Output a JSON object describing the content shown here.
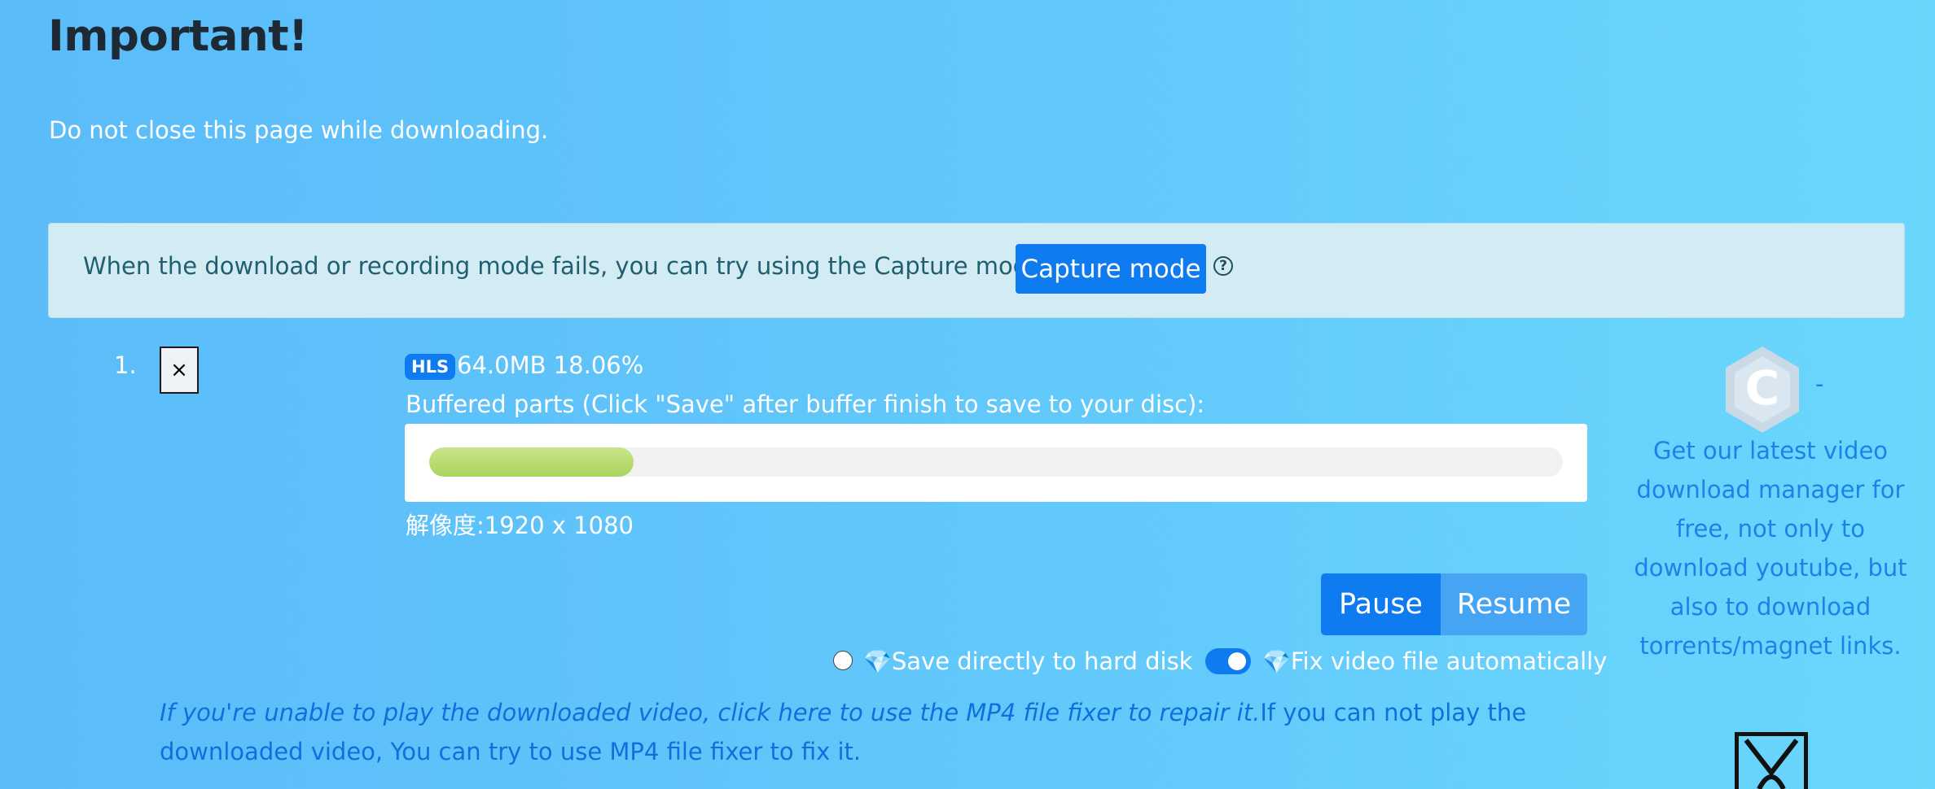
{
  "header": {
    "title": "Important!",
    "warning": "Do not close this page while downloading."
  },
  "info_box": {
    "text": "When the download or recording mode fails, you can try using the Capture mode:",
    "capture_button": "Capture mode",
    "help_icon": "question-circle-icon",
    "help_glyph": "?"
  },
  "download_item": {
    "index": "1.",
    "close_glyph": "×",
    "format_badge": "HLS",
    "size_progress": "64.0MB 18.06%",
    "buffered_label": "Buffered parts (Click \"Save\" after buffer finish to save to your disc):",
    "progress_fraction": 0.18,
    "resolution": "解像度:1920 x 1080",
    "pause_button": "Pause",
    "resume_button": "Resume",
    "gem_icon": "diamond-icon",
    "gem_glyph": "💎",
    "save_to_disk_label": "Save directly to hard disk",
    "save_to_disk_checked": false,
    "fix_video_label": "Fix video file automatically",
    "fix_video_enabled": true
  },
  "bottom": {
    "fixer_link": "If you're unable to play the downloaded video, click here to use the MP4 file fixer to repair it.",
    "fixer_text": "If you can not play the downloaded video, You can try to use MP4 file fixer to fix it."
  },
  "promo": {
    "logo_letter": "C",
    "dash": "-",
    "text": "Get our latest video download manager for free, not only to download youtube, but also to download torrents/magnet links."
  },
  "colors": {
    "accent": "#0e7cf0",
    "progress": "#b8dc72",
    "link": "#0e70dd"
  }
}
